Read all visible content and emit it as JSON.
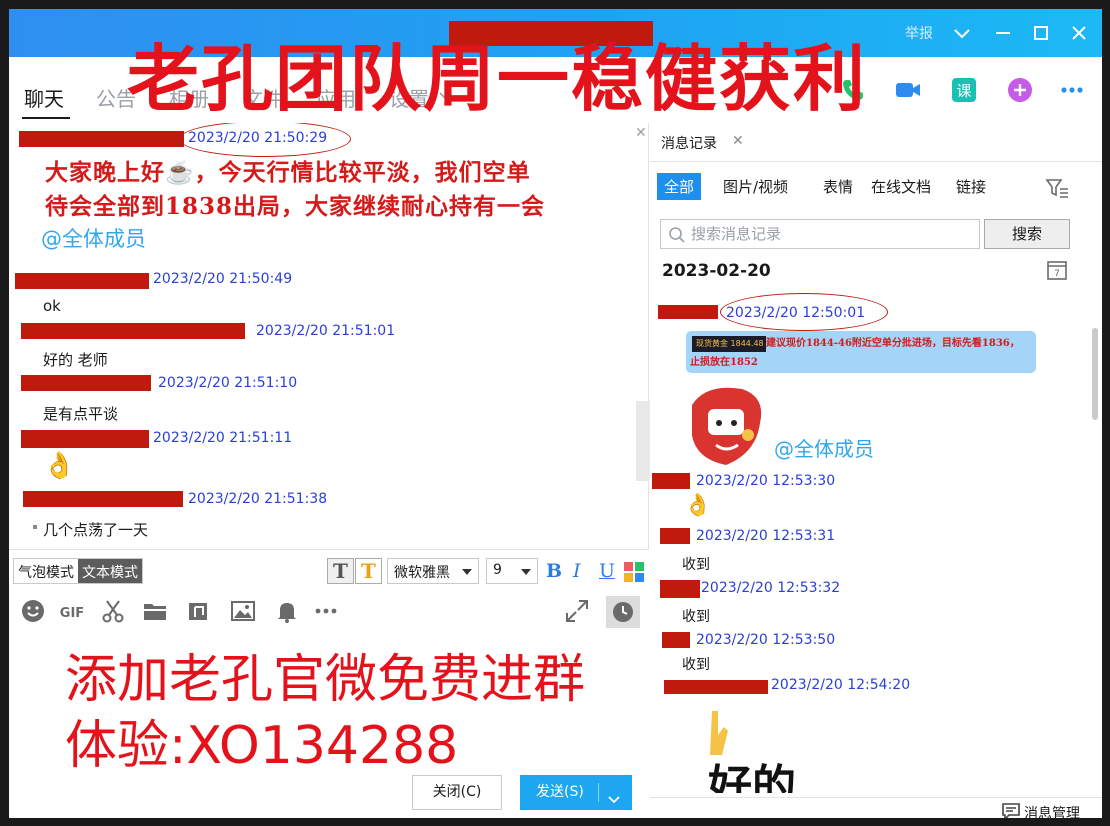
{
  "window": {
    "report_label": "举报"
  },
  "banner": {
    "top": "老孔团队周一稳健获利",
    "promo_line1": "添加老孔官微免费进群",
    "promo_line2": "体验:XO134288"
  },
  "tabs": [
    {
      "label": "聊天",
      "active": true
    },
    {
      "label": "公告"
    },
    {
      "label": "相册"
    },
    {
      "label": "文件"
    },
    {
      "label": "应用"
    },
    {
      "label": "设置"
    }
  ],
  "chat": {
    "notice_line1": "大家晚上好☕，今天行情比较平淡，我们空单",
    "notice_line2": "待会全部到1838出局，大家继续耐心持有一会",
    "mention": "@全体成员",
    "messages": [
      {
        "time": "2023/2/20 21:50:29"
      },
      {
        "time": "2023/2/20 21:50:49",
        "text": "ok"
      },
      {
        "time": "2023/2/20 21:51:01",
        "text": "好的 老师"
      },
      {
        "time": "2023/2/20 21:51:10",
        "text": "是有点平谈"
      },
      {
        "time": "2023/2/20 21:51:11",
        "text": "👌"
      },
      {
        "time": "2023/2/20 21:51:38",
        "text": "几个点荡了一天"
      }
    ]
  },
  "composer": {
    "mode_bubble": "气泡模式",
    "mode_text": "文本模式",
    "font_name": "微软雅黑",
    "font_size": "9",
    "bold": "B",
    "italic": "I",
    "underline": "U",
    "close_label": "关闭(C)",
    "send_label": "发送(S)"
  },
  "history": {
    "tab_label": "消息记录",
    "filters": [
      "全部",
      "图片/视频",
      "表情",
      "在线文档",
      "链接"
    ],
    "search_placeholder": "搜索消息记录",
    "search_button": "搜索",
    "date": "2023-02-20",
    "calendar_day": "7",
    "image_tag": "现货黄金 1844.48",
    "image_text": "建议现价1844-46附近空单分批进场，目标先看1836，",
    "image_text2": "止损放在1852",
    "mention": "@全体成员",
    "entries": [
      {
        "time": "2023/2/20 12:50:01"
      },
      {
        "time": "2023/2/20 12:53:30",
        "text": "👌"
      },
      {
        "time": "2023/2/20 12:53:31",
        "text": "收到"
      },
      {
        "time": "2023/2/20 12:53:32",
        "text": "收到"
      },
      {
        "time": "2023/2/20 12:53:50",
        "text": "收到"
      },
      {
        "time": "2023/2/20 12:54:20"
      }
    ],
    "sticker_text": "好的",
    "manage_label": "消息管理"
  },
  "colors": {
    "titlebar": "#1ea3f3",
    "accent": "#1e8fee",
    "time_blue": "#2a3fd6",
    "promo_red": "#e4131b",
    "redaction": "#c01a0f"
  }
}
